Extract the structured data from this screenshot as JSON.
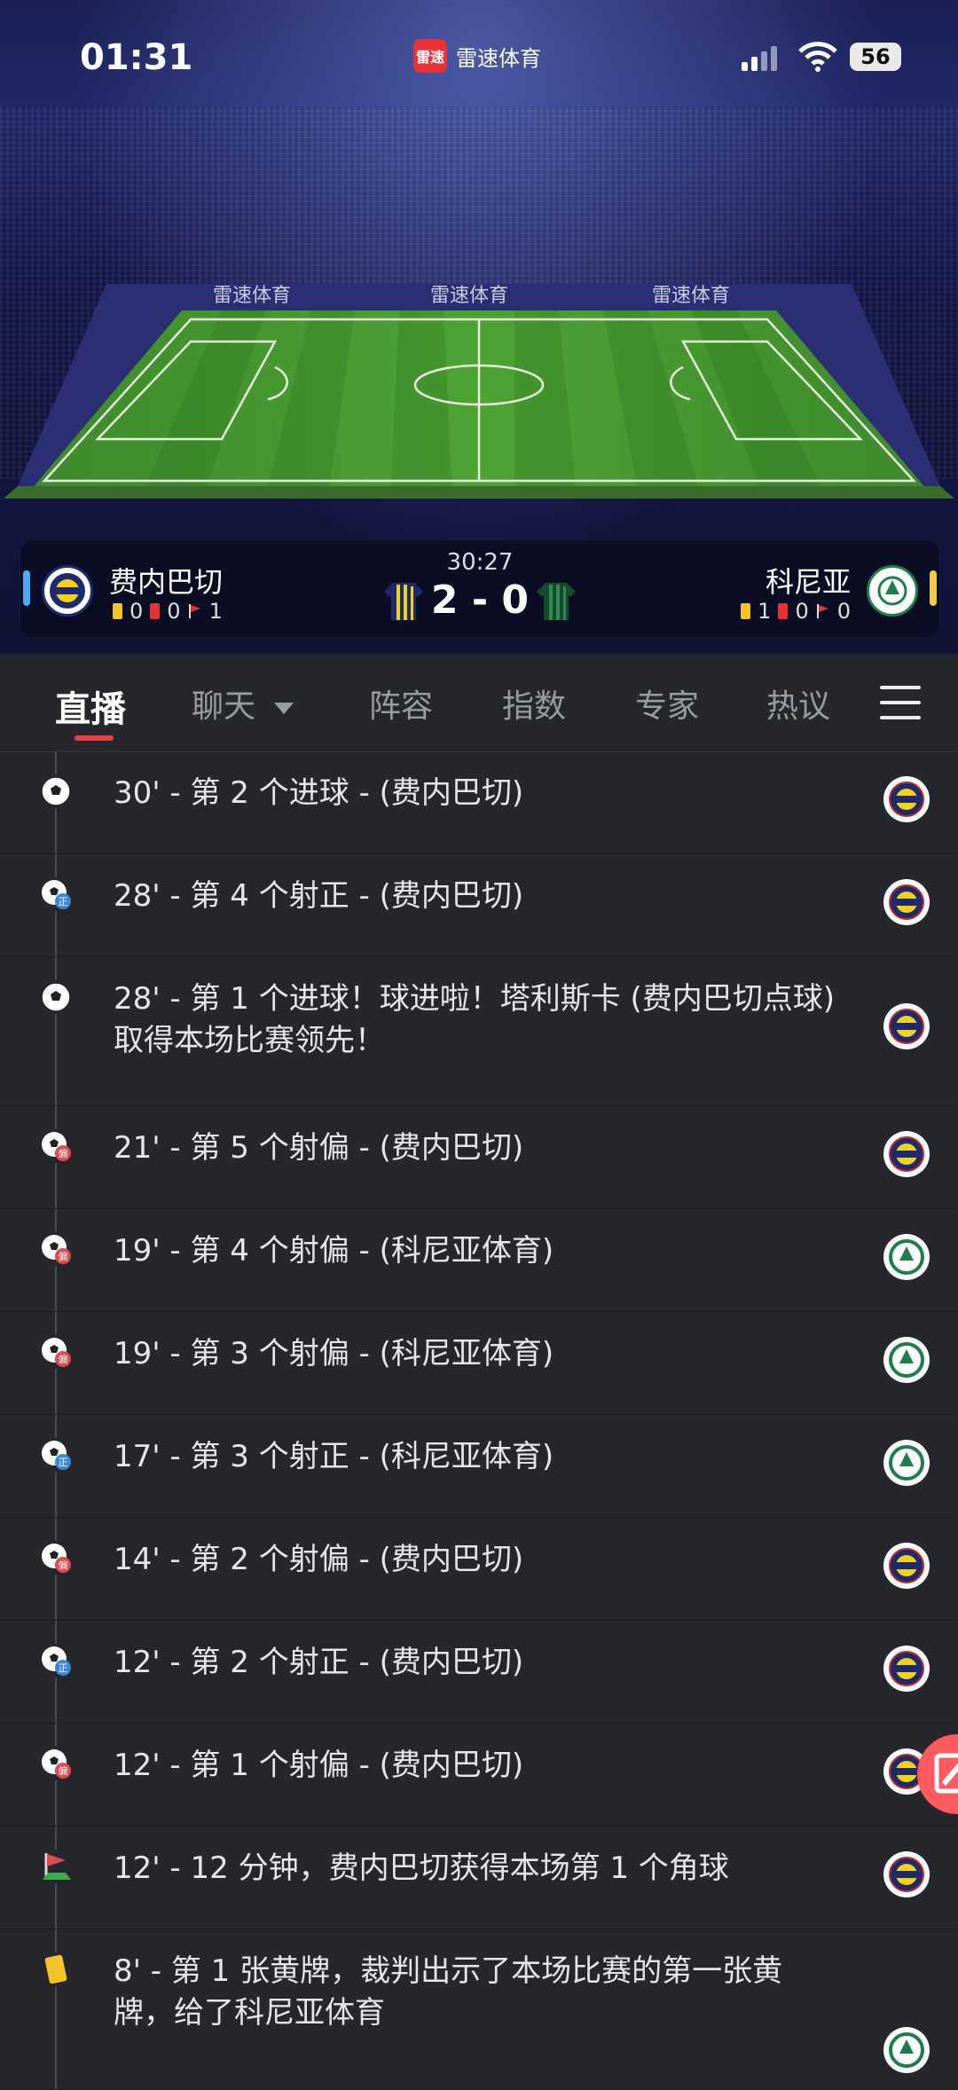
{
  "status": {
    "time": "01:31",
    "app_name": "雷速体育",
    "battery": "56"
  },
  "match": {
    "clock": "30:27",
    "score": "2 - 0",
    "home": {
      "name": "费内巴切",
      "yellow": "0",
      "red": "0",
      "corners": "1"
    },
    "away": {
      "name": "科尼亚",
      "yellow": "1",
      "red": "0",
      "corners": "0"
    }
  },
  "tabs": [
    "直播",
    "聊天",
    "阵容",
    "指数",
    "专家",
    "热议"
  ],
  "events": [
    {
      "icon": "goal-icon",
      "text": "30' - 第 2 个进球 - (费内巴切)",
      "team": "home"
    },
    {
      "icon": "shot-on-target-icon",
      "text": "28' - 第 4 个射正 - (费内巴切)",
      "team": "home"
    },
    {
      "icon": "goal-icon",
      "text": "28' - 第 1 个进球！球进啦！塔利斯卡 (费内巴切点球) 取得本场比赛领先！",
      "team": "home"
    },
    {
      "icon": "shot-off-target-icon",
      "text": "21' - 第 5 个射偏 - (费内巴切)",
      "team": "home"
    },
    {
      "icon": "shot-off-target-icon",
      "text": "19' - 第 4 个射偏 - (科尼亚体育)",
      "team": "away"
    },
    {
      "icon": "shot-off-target-icon",
      "text": "19' - 第 3 个射偏 - (科尼亚体育)",
      "team": "away"
    },
    {
      "icon": "shot-on-target-icon",
      "text": "17' - 第 3 个射正 - (科尼亚体育)",
      "team": "away"
    },
    {
      "icon": "shot-off-target-icon",
      "text": "14' - 第 2 个射偏 - (费内巴切)",
      "team": "home"
    },
    {
      "icon": "shot-on-target-icon",
      "text": "12' - 第 2 个射正 - (费内巴切)",
      "team": "home"
    },
    {
      "icon": "shot-off-target-icon",
      "text": "12' - 第 1 个射偏 - (费内巴切)",
      "team": "home"
    },
    {
      "icon": "corner-flag-icon",
      "text": "12' - 12 分钟，费内巴切获得本场第 1 个角球",
      "team": "home"
    },
    {
      "icon": "yellow-card-icon",
      "text": "8' - 第 1 张黄牌，裁判出示了本场比赛的第一张黄牌，给了科尼亚体育",
      "team": "away"
    }
  ],
  "colors": {
    "accent": "#e8414b",
    "home_indicator": "#4fa8f2",
    "away_indicator": "#f2c94c",
    "yellow_card": "#f4c22b",
    "red_card": "#e23434"
  }
}
